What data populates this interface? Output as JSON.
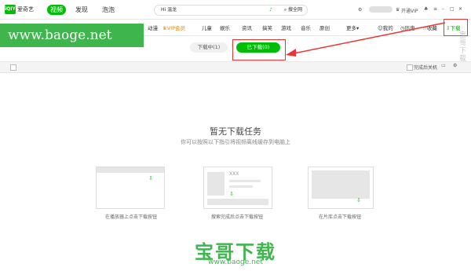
{
  "app": {
    "logo_text": "iQIY",
    "name": "爱奇艺"
  },
  "topnav": {
    "tabs": [
      "视频",
      "发现",
      "泡泡"
    ]
  },
  "search": {
    "value": "Hi 温龙",
    "button": "搜全网"
  },
  "top_right": {
    "vip": "开通VIP"
  },
  "nav2": {
    "items": [
      "动漫",
      "VIP会员",
      "儿童",
      "娱乐",
      "资讯",
      "搞笑",
      "游戏",
      "音乐",
      "原创",
      "更多"
    ],
    "right": [
      "我的",
      "历史",
      "收藏",
      "下载"
    ]
  },
  "watermark": {
    "url_banner": "www.baoge.net",
    "brand": "宝哥下载",
    "url": "www.baoge.net",
    "side": "宝哥下载"
  },
  "download_tabs": {
    "downloading": "下载中(1)",
    "downloaded": "已下载(0)"
  },
  "toolbar": {
    "shutdown": "完成后关机"
  },
  "empty": {
    "title": "暂无下载任务",
    "subtitle": "你可以按照以下指引将视频离线缓存到电脑上"
  },
  "cards": [
    {
      "caption": "在播放器上点击下载按钮",
      "placeholder": ""
    },
    {
      "caption": "搜索完成后点击下载按钮",
      "placeholder": "XXX"
    },
    {
      "caption": "在片库点击下载按钮",
      "placeholder": ""
    }
  ],
  "colors": {
    "accent": "#00be06",
    "annotation": "#e33333",
    "watermark": "#3fb54d"
  }
}
